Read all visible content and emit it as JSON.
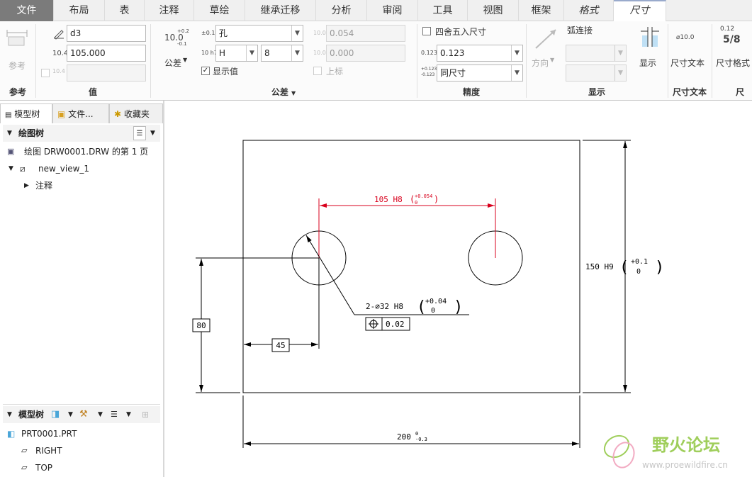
{
  "tabs": [
    "文件",
    "布局",
    "表",
    "注释",
    "草绘",
    "继承迁移",
    "分析",
    "审阅",
    "工具",
    "视图",
    "框架",
    "格式",
    "尺寸"
  ],
  "ribbon": {
    "ref_label": "参考",
    "value_group_label": "值",
    "tol_group_label": "公差",
    "precision_group_label": "精度",
    "display_group_label": "显示",
    "dimtext_group_label": "尺寸文本",
    "dimformat_group_label": "尺寸",
    "name_value": "d3",
    "value_value": "105.000",
    "tol_btn": "公差",
    "tol_icon_text": "10.0",
    "tol_icon_sup": "+0.2",
    "tol_icon_sub": "-0.1",
    "hole_label": "孔",
    "fit_letter": "H",
    "fit_grade": "8",
    "upper_value": "0.054",
    "lower_value": "0.000",
    "show_value_label": "显示值",
    "upper_label": "上标",
    "round_label": "四舍五入尺寸",
    "precision_value": "0.123",
    "same_size_label": "同尺寸",
    "direction_label": "方向",
    "arc_label": "弧连接",
    "display_btn": "显示",
    "dim_text_btn": "尺寸文本",
    "dim_format_btn": "尺寸格式",
    "dim_text_icon": "⌀10.0",
    "dim_format_icon_top": "0.12",
    "dim_format_icon_bottom": "5/8",
    "precision_icon": "0.123",
    "same_icon_top": "+0.123",
    "same_icon_bottom": "-0.123",
    "tol_small_icon": "±0.1",
    "fit_small_icon": "10 h7",
    "val_small_icon": "10.4",
    "up_small_icon": "10.0",
    "low_small_icon": "10.0"
  },
  "panel": {
    "tab_model_tree": "模型树",
    "tab_files": "文件...",
    "tab_favorites": "收藏夹",
    "drawing_tree_label": "绘图树",
    "drawing_item": "绘图 DRW0001.DRW 的第 1 页",
    "view_item": "new_view_1",
    "note_item": "注释",
    "model_tree_label": "模型树",
    "part_item": "PRT0001.PRT",
    "right_item": "RIGHT",
    "top_item": "TOP"
  },
  "drawing": {
    "dim_105": "105 H8",
    "dim_105_up": "+0.054",
    "dim_105_low": "0",
    "dim_150": "150 H9",
    "dim_150_up": "+0.1",
    "dim_150_low": "0",
    "hole_note": "2-⌀32 H8",
    "hole_up": "+0.04",
    "hole_low": "0",
    "pos_tol": "0.02",
    "dim_80": "80",
    "dim_45": "45",
    "dim_200": "200",
    "dim_200_up": "0",
    "dim_200_low": "-0.3",
    "watermark_cn": "野火论坛",
    "watermark_url": "www.proewildfire.cn"
  },
  "colors": {
    "accent_red": "#d8001c",
    "file_tab": "#7b7b7b",
    "watermark": "#8fc63f"
  }
}
